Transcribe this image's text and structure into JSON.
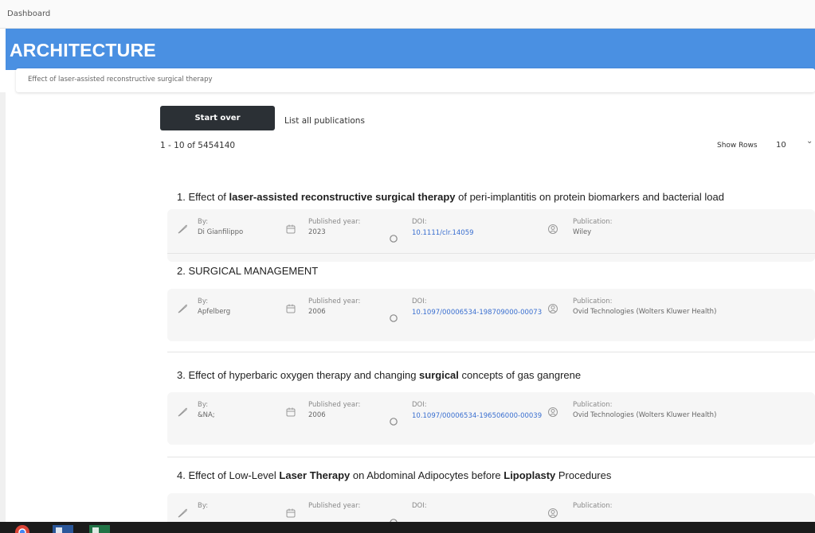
{
  "topbar": {
    "breadcrumb": "Dashboard"
  },
  "banner": {
    "title": "ARCHITECTURE"
  },
  "search": {
    "query": "Effect of laser-assisted reconstructive surgical therapy"
  },
  "actions": {
    "start_over": "Start over",
    "list_all": "List all publications"
  },
  "results": {
    "range": "1 - 10 of 5454140",
    "show_rows_label": "Show Rows",
    "rows_value": "10"
  },
  "labels": {
    "by": "By:",
    "year": "Published year:",
    "doi": "DOI:",
    "publication": "Publication:"
  },
  "publications": [
    {
      "number": "1.",
      "title_parts": [
        {
          "t": "Effect of ",
          "b": false
        },
        {
          "t": "laser-assisted reconstructive surgical therapy",
          "b": true
        },
        {
          "t": " of peri-implantitis on protein biomarkers and bacterial load",
          "b": false
        }
      ],
      "by": "Di Gianfilippo",
      "year": "2023",
      "doi": "10.1111/clr.14059",
      "publication": "Wiley"
    },
    {
      "number": "2.",
      "title_parts": [
        {
          "t": "SURGICAL MANAGEMENT",
          "b": false
        }
      ],
      "by": "Apfelberg",
      "year": "2006",
      "doi": "10.1097/00006534-198709000-00073",
      "publication": "Ovid Technologies (Wolters Kluwer Health)"
    },
    {
      "number": "3.",
      "title_parts": [
        {
          "t": "Effect of hyperbaric oxygen therapy and changing ",
          "b": false
        },
        {
          "t": "surgical",
          "b": true
        },
        {
          "t": " concepts of gas gangrene",
          "b": false
        }
      ],
      "by": "&NA;",
      "year": "2006",
      "doi": "10.1097/00006534-196506000-00039",
      "publication": "Ovid Technologies (Wolters Kluwer Health)"
    },
    {
      "number": "4.",
      "title_parts": [
        {
          "t": "Effect of Low-Level ",
          "b": false
        },
        {
          "t": "Laser Therapy",
          "b": true
        },
        {
          "t": " on Abdominal Adipocytes before ",
          "b": false
        },
        {
          "t": "Lipoplasty",
          "b": true
        },
        {
          "t": " Procedures",
          "b": false
        }
      ],
      "by": "",
      "year": "",
      "doi": "",
      "publication": ""
    }
  ],
  "colors": {
    "banner": "#4a90e2",
    "link": "#3a6fd0",
    "button": "#2b3035"
  },
  "icons": {
    "author": "feather-pen-icon",
    "year": "calendar-icon",
    "doi": "circle-icon",
    "publication": "user-circle-icon",
    "rows": "chevron-down-icon"
  }
}
